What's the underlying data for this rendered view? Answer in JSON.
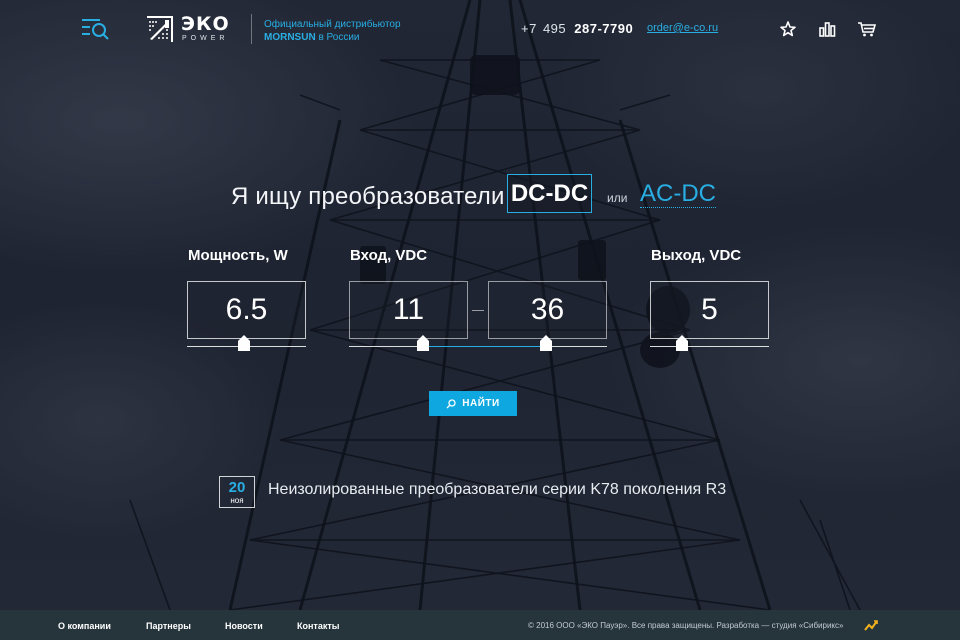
{
  "header": {
    "logo": {
      "word": "ЭКО",
      "sub": "POWER"
    },
    "tagline": {
      "line1": "Официальный дистрибьютор",
      "brand": "MORNSUN",
      "suffix": " в России"
    },
    "phone": {
      "code": "+7",
      "area": "495",
      "number": "287-7790"
    },
    "email": "order@e-co.ru",
    "icons": [
      "menu-search-icon",
      "star-icon",
      "compare-icon",
      "cart-icon"
    ]
  },
  "search": {
    "prefix": "Я ищу преобразователи",
    "type_selected": "DC-DC",
    "or": "или",
    "type_alt": "AC-DC",
    "fields": {
      "power": {
        "label": "Мощность, W",
        "value": "6.5"
      },
      "input": {
        "label": "Вход, VDC",
        "min": "11",
        "max": "36"
      },
      "output": {
        "label": "Выход, VDC",
        "value": "5"
      }
    },
    "button": "НАЙТИ"
  },
  "news": {
    "day": "20",
    "month": "ноя",
    "title": "Неизолированные преобразователи серии K78 поколения R3"
  },
  "footer": {
    "nav": [
      "О компании",
      "Партнеры",
      "Новости",
      "Контакты"
    ],
    "copyright": "© 2016 ООО «ЭКО Пауэр». Все права защищены. Разработка — студия «Сибирикс»"
  },
  "colors": {
    "accent": "#29aee3",
    "button": "#0fa7df",
    "footer": "#28383e"
  }
}
